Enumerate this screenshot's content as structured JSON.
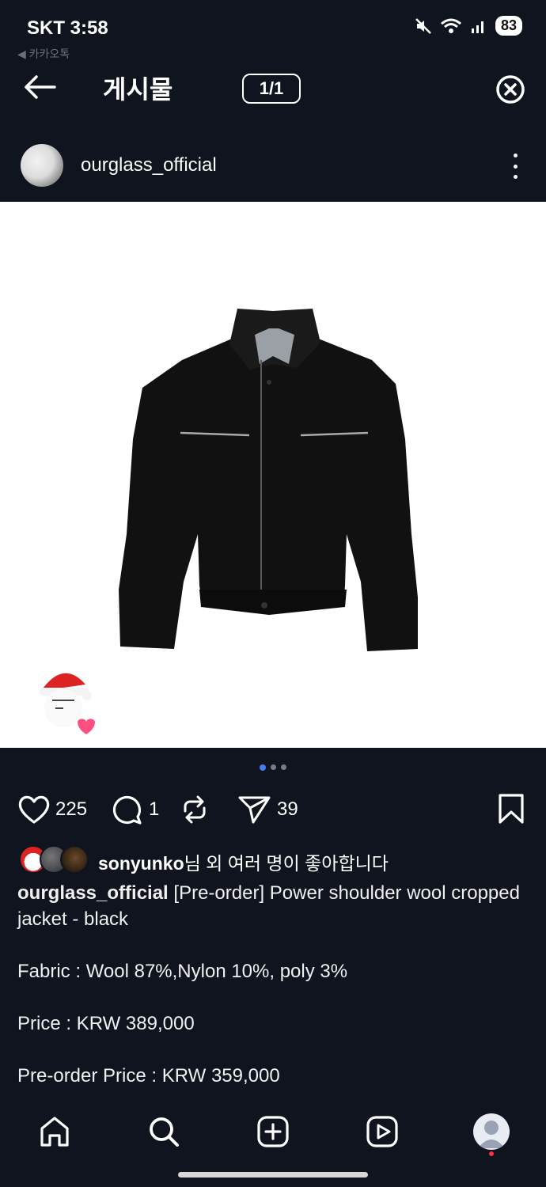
{
  "status_bar": {
    "carrier_time": "SKT 3:58",
    "back_app": "◀ 카카오톡",
    "battery": "83"
  },
  "header": {
    "title": "게시물",
    "page_counter": "1/1"
  },
  "post": {
    "username": "ourglass_official",
    "carousel": {
      "count": 3,
      "active": 1
    },
    "likes": "225",
    "comments": "1",
    "shares": "39",
    "liked_by_user": "sonyunko",
    "liked_by_suffix": "님 외 여러 명이 좋아합니다",
    "caption_user": "ourglass_official",
    "caption_title": "[Pre-order] Power shoulder wool cropped jacket - black",
    "caption_fabric": "Fabric : Wool 87%,Nylon 10%, poly 3%",
    "caption_price": "Price : KRW 389,000",
    "caption_preorder_price": "Pre-order Price : KRW 359,000"
  },
  "icons": {
    "back": "arrow-left-icon",
    "close": "close-circle-icon",
    "more": "more-vertical-icon",
    "like": "heart-icon",
    "comment": "comment-icon",
    "repost": "repost-icon",
    "share": "send-icon",
    "save": "bookmark-icon",
    "home": "home-icon",
    "search": "search-icon",
    "create": "plus-square-icon",
    "reels": "reels-icon",
    "profile": "profile-avatar-icon"
  },
  "colors": {
    "background": "#0f141e",
    "text": "#f5f5f5",
    "carousel_active": "#4a7cf0",
    "notification_dot": "#ff3040"
  }
}
